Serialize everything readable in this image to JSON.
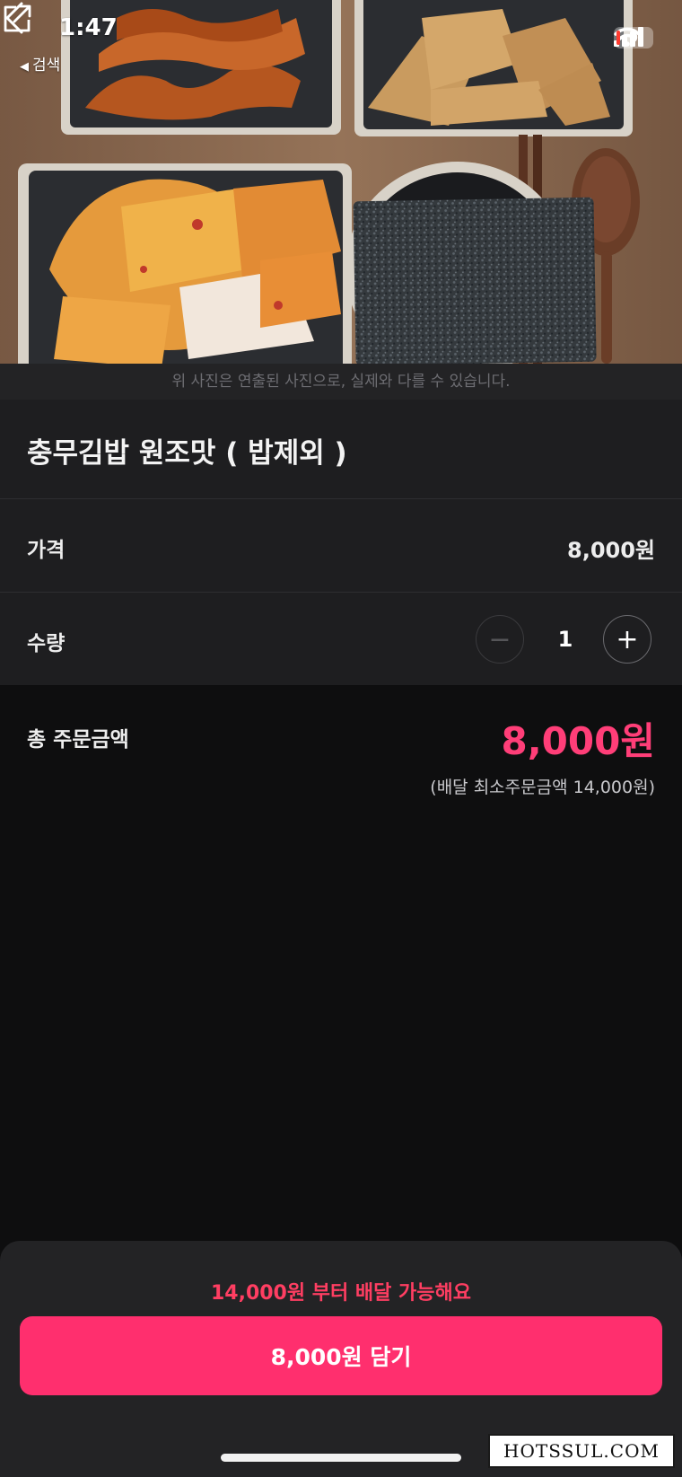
{
  "status_bar": {
    "time": "1:47",
    "back_app_label": "검색",
    "battery_level": "9"
  },
  "hero": {
    "image_subject": "side dishes photo",
    "disclaimer": "위 사진은 연출된 사진으로, 실제와 다를 수 있습니다."
  },
  "nav": {
    "back_icon": "chevron-left-icon",
    "share_icon": "share-icon"
  },
  "product": {
    "name": "충무김밥 원조맛 ( 밥제외 )",
    "price_label": "가격",
    "price_value": "8,000원",
    "quantity_label": "수량",
    "quantity_value": "1",
    "minus_symbol": "−",
    "plus_symbol": "+"
  },
  "total": {
    "label": "총 주문금액",
    "value": "8,000원",
    "min_order_note": "(배달 최소주문금액 14,000원)"
  },
  "bottom": {
    "delivery_note": "14,000원 부터 배달 가능해요",
    "add_button_label": "8,000원 담기"
  },
  "watermark": {
    "text": "HOTSSUL.COM"
  },
  "colors": {
    "accent": "#ff2f6e",
    "price_accent": "#ff3e78",
    "notice": "#ff3e62",
    "panel": "#1e1e20",
    "background": "#0e0e0f"
  }
}
